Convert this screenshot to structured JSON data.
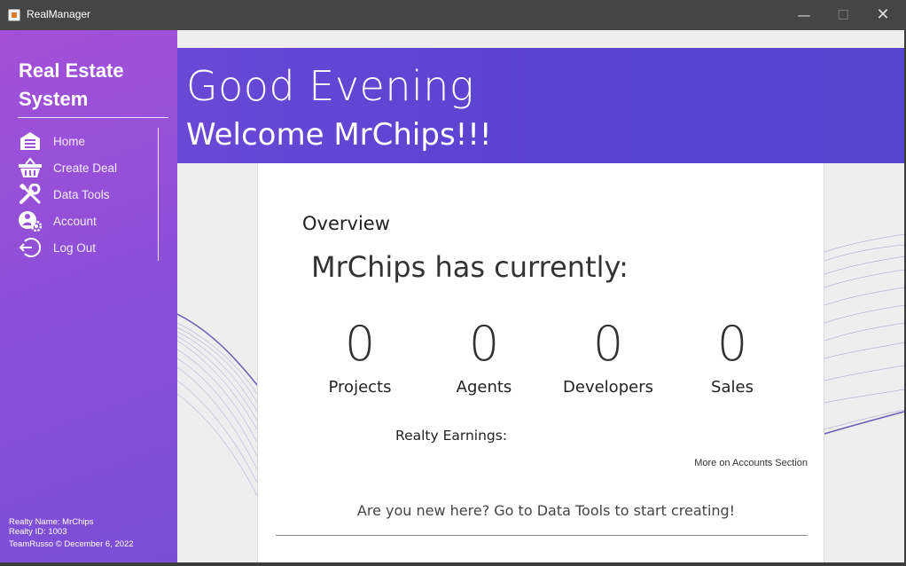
{
  "window": {
    "title": "RealManager",
    "minimize": "—",
    "maximize": "☐",
    "close": "✕"
  },
  "sidebar": {
    "brand_line1": "Real Estate",
    "brand_line2": "System",
    "items": [
      {
        "label": "Home",
        "icon": "home-icon"
      },
      {
        "label": "Create Deal",
        "icon": "basket-icon"
      },
      {
        "label": "Data Tools",
        "icon": "tools-icon"
      },
      {
        "label": "Account",
        "icon": "account-settings-icon"
      },
      {
        "label": "Log Out",
        "icon": "logout-icon"
      }
    ],
    "realty_name": "Realty Name: MrChips",
    "realty_id": "Realty ID: 1003",
    "copyright": "TeamRusso © December 6, 2022"
  },
  "banner": {
    "greeting": "Good Evening",
    "welcome": "Welcome MrChips!!!"
  },
  "overview": {
    "heading": "Overview",
    "subheading": "MrChips has currently:",
    "stats": [
      {
        "value": "0",
        "label": "Projects"
      },
      {
        "value": "0",
        "label": "Agents"
      },
      {
        "value": "0",
        "label": "Developers"
      },
      {
        "value": "0",
        "label": "Sales"
      }
    ],
    "earnings_label": "Realty Earnings:",
    "more_link": "More on Accounts Section",
    "cta": "Are you new here? Go to Data Tools to start creating!"
  },
  "colors": {
    "sidebar_top": "#a450d8",
    "sidebar_bottom": "#7a4fd6",
    "banner": "#5a43d0",
    "background": "#eeeeee"
  }
}
